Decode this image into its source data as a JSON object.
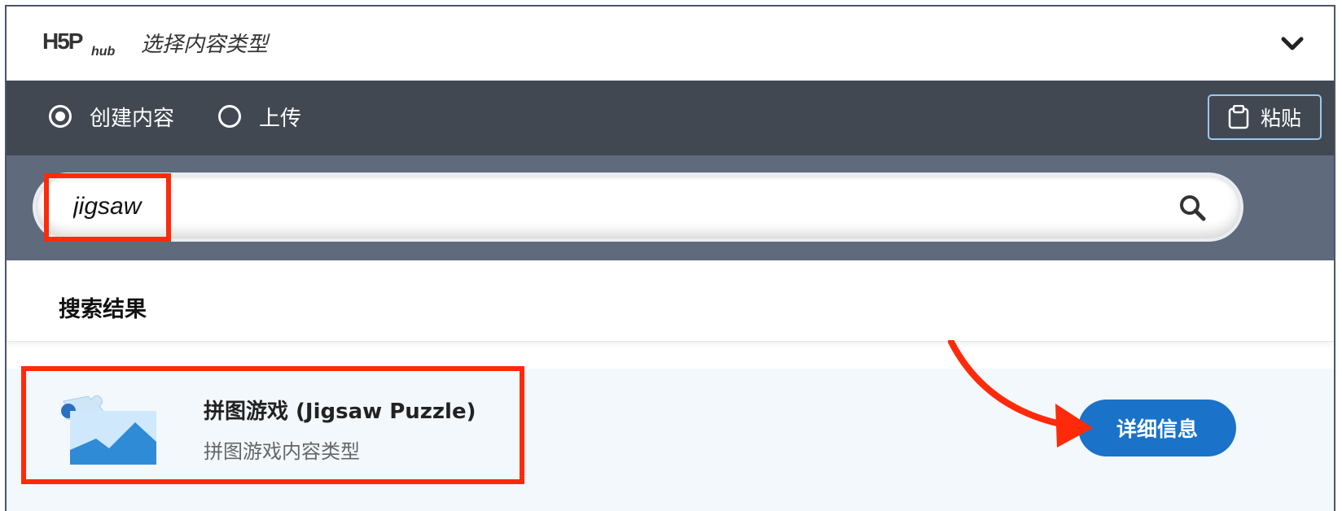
{
  "header": {
    "logo_text": "H5P hub",
    "title": "选择内容类型"
  },
  "tabs": {
    "create_label": "创建内容",
    "upload_label": "上传",
    "paste_label": "粘贴"
  },
  "search": {
    "value": "jigsaw"
  },
  "results": {
    "heading": "搜索结果",
    "items": [
      {
        "title": "拼图游戏 (Jigsaw Puzzle)",
        "description": "拼图游戏内容类型",
        "details_label": "详细信息"
      }
    ]
  },
  "colors": {
    "tabs_bg": "#414852",
    "search_bg": "#5f6b7c",
    "accent": "#1a73c8",
    "highlight": "#ff2a0a",
    "result_bg": "#f3f8fd"
  },
  "icons": [
    "h5p-logo",
    "chevron-down-icon",
    "radio-checked-icon",
    "radio-unchecked-icon",
    "clipboard-icon",
    "search-icon",
    "jigsaw-thumbnail"
  ]
}
